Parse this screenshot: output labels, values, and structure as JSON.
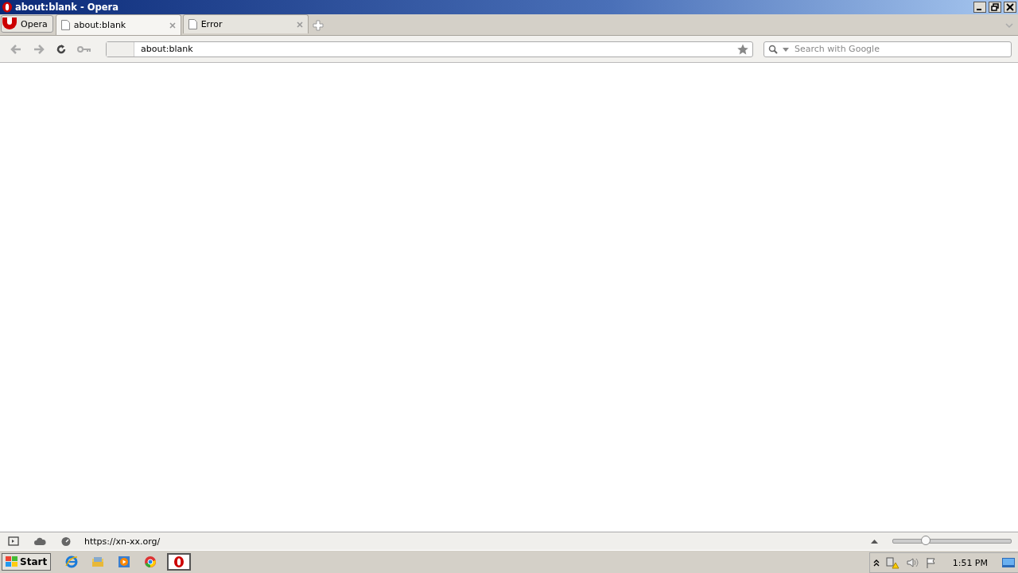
{
  "window": {
    "title": "about:blank - Opera"
  },
  "menu_button": {
    "label": "Opera"
  },
  "tabs": [
    {
      "label": "about:blank",
      "selected": true
    },
    {
      "label": "Error",
      "selected": false
    }
  ],
  "address_bar": {
    "value": "about:blank"
  },
  "search": {
    "placeholder": "Search with Google"
  },
  "status_bar": {
    "url": "https://xn-xx.org/",
    "zoom": {
      "level": 0.28
    }
  },
  "taskbar": {
    "start": "Start",
    "apps": [
      {
        "kind": "ie",
        "selected": false
      },
      {
        "kind": "explorer",
        "selected": false
      },
      {
        "kind": "media",
        "selected": false
      },
      {
        "kind": "chrome",
        "selected": false
      },
      {
        "kind": "opera",
        "selected": true
      }
    ],
    "clock": "1:51 PM"
  }
}
